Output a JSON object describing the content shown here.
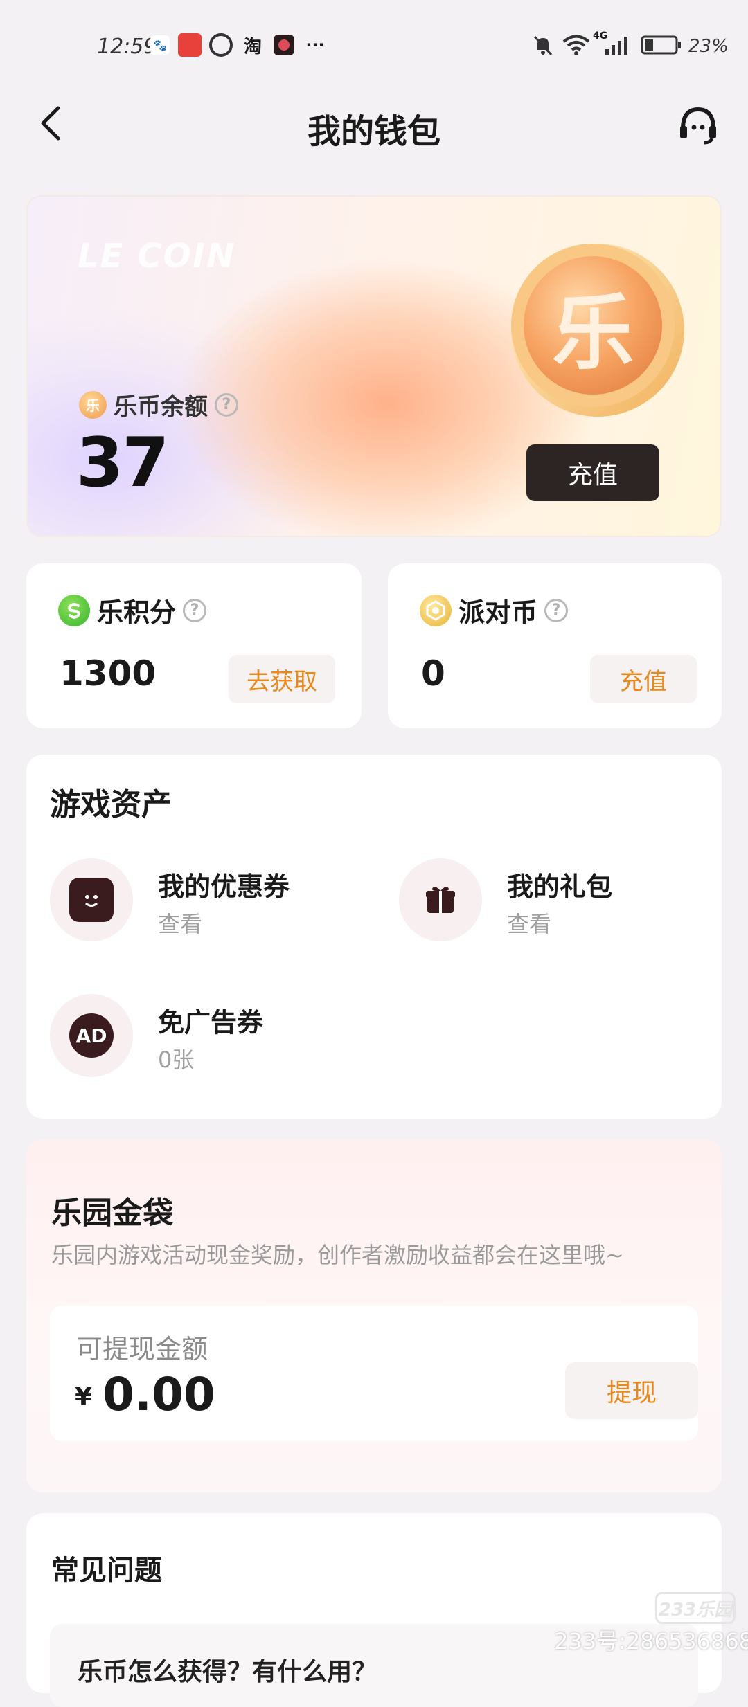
{
  "status_bar": {
    "time": "12:59",
    "notification_icons": [
      "baidu-app-icon",
      "huawei-app-icon",
      "quark-app-icon",
      "taobao-app-icon",
      "red-app-icon"
    ],
    "more": "···",
    "network": "4G",
    "battery": "23%"
  },
  "header": {
    "title": "我的钱包"
  },
  "lecoin": {
    "watermark": "LE COIN",
    "coin_char": "乐",
    "small_coin_char": "乐",
    "label": "乐币余额",
    "amount": "37",
    "recharge_label": "充值"
  },
  "points": {
    "label": "乐积分",
    "value": "1300",
    "button": "去获取"
  },
  "party": {
    "label": "派对币",
    "value": "0",
    "button": "充值"
  },
  "assets": {
    "title": "游戏资产",
    "items": [
      {
        "name": "我的优惠券",
        "sub": "查看"
      },
      {
        "name": "我的礼包",
        "sub": "查看"
      },
      {
        "name": "免广告券",
        "sub": "0张",
        "icon_text": "AD"
      }
    ]
  },
  "gold_bag": {
    "title": "乐园金袋",
    "description": "乐园内游戏活动现金奖励，创作者激励收益都会在这里哦~",
    "withdraw_label": "可提现金额",
    "currency": "¥",
    "amount": "0.00",
    "withdraw_button": "提现"
  },
  "faq": {
    "title": "常见问题",
    "first_question": "乐币怎么获得？有什么用？"
  },
  "watermark": {
    "logo": "233乐园",
    "text": "233号:286536868"
  }
}
